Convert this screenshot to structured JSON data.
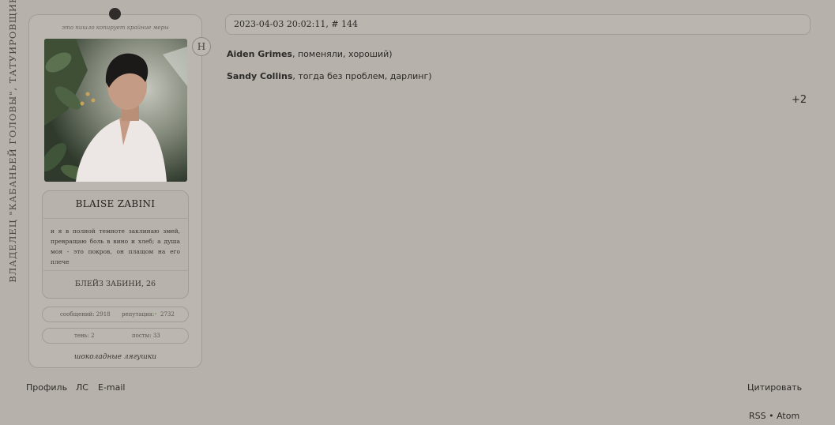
{
  "sidebar": {
    "vertical_title": "ВЛАДЕЛЕЦ \"КАБАНЬЕЙ ГОЛОВЫ\", ТАТУИРОВЩИК"
  },
  "profile": {
    "note": "это пишло копирует крайние меры",
    "badge": "H",
    "name": "BLAISE ZABINI",
    "quote": "и я в полной темноте заклинаю змей, превращаю боль в вино и хлеб; а душа моя - это покров, он плащом на его плече",
    "russian_name": "БЛЕЙЗ ЗАБИНИ, 26",
    "messages": "сообщений: 2918",
    "reputation_label": "репутация:",
    "reputation_icon": "plus-icon",
    "reputation_value": "2732",
    "posts_extra": "тень: 2",
    "posts": "посты: 33",
    "footer": "шоколадные лягушки"
  },
  "post": {
    "header": "2023-04-03 20:02:11, # 144",
    "replies": [
      {
        "author": "Aiden Grimes",
        "text": ", поменяли, хороший)"
      },
      {
        "author": "Sandy Collins",
        "text": ", тогда без проблем, дарлинг)"
      }
    ],
    "plus_count": "+2"
  },
  "links": {
    "profile": "Профиль",
    "pm": "ЛС",
    "email": "E-mail",
    "quote": "Цитировать",
    "feeds": "RSS • Atom"
  },
  "colors": {
    "background": "#b7b1ab",
    "card": "#bcb6b0",
    "text": "#2c2a28",
    "accent_green": "#6aa84f"
  }
}
